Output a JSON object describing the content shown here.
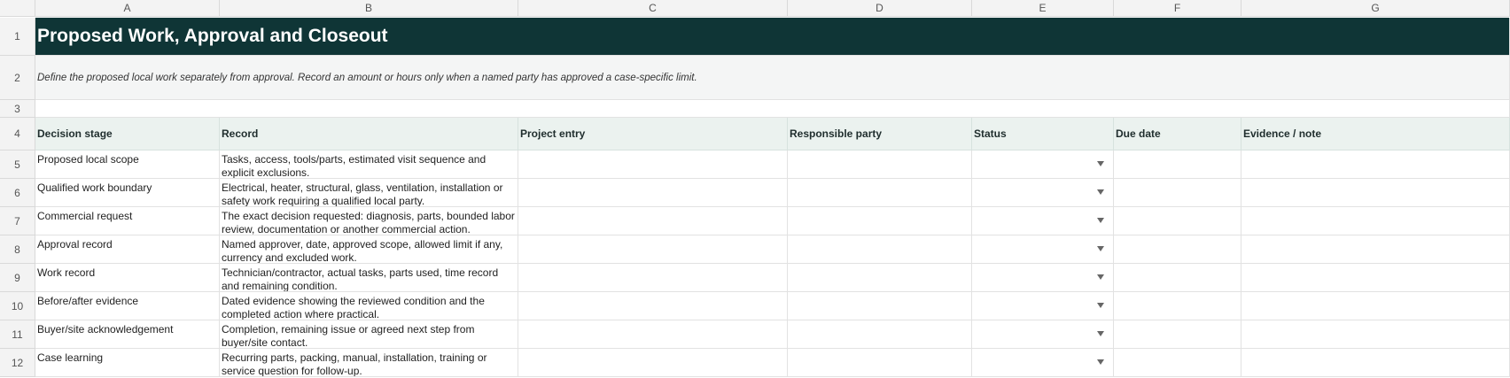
{
  "columns": [
    "A",
    "B",
    "C",
    "D",
    "E",
    "F",
    "G"
  ],
  "row_numbers": [
    "1",
    "2",
    "3",
    "4",
    "5",
    "6",
    "7",
    "8",
    "9",
    "10",
    "11",
    "12"
  ],
  "title": "Proposed Work, Approval and Closeout",
  "subtitle": "Define the proposed local work separately from approval. Record an amount or hours only when a named party has approved a case-specific limit.",
  "headers": [
    "Decision stage",
    "Record",
    "Project entry",
    "Responsible party",
    "Status",
    "Due date",
    "Evidence / note"
  ],
  "rows": [
    {
      "stage": "Proposed local scope",
      "record": "Tasks, access, tools/parts, estimated visit sequence and explicit exclusions."
    },
    {
      "stage": "Qualified work boundary",
      "record": "Electrical, heater, structural, glass, ventilation, installation or safety work requiring a qualified local party."
    },
    {
      "stage": "Commercial request",
      "record": "The exact decision requested: diagnosis, parts, bounded labor review, documentation or another commercial action."
    },
    {
      "stage": "Approval record",
      "record": "Named approver, date, approved scope, allowed limit if any, currency and excluded work."
    },
    {
      "stage": "Work record",
      "record": "Technician/contractor, actual tasks, parts used, time record and remaining condition."
    },
    {
      "stage": "Before/after evidence",
      "record": "Dated evidence showing the reviewed condition and the completed action where practical."
    },
    {
      "stage": "Buyer/site acknowledgement",
      "record": "Completion, remaining issue or agreed next step from buyer/site contact."
    },
    {
      "stage": "Case learning",
      "record": "Recurring parts, packing, manual, installation, training or service question for follow-up."
    }
  ]
}
